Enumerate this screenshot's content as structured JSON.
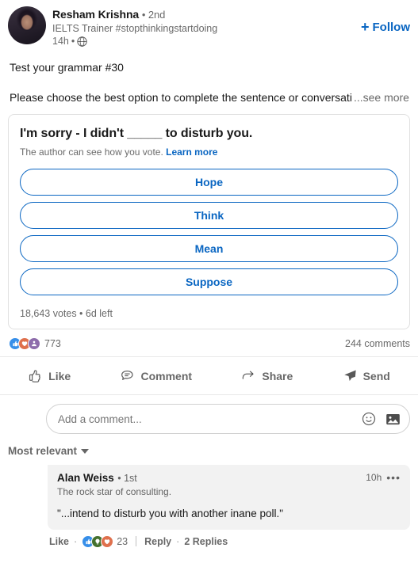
{
  "post": {
    "author": {
      "name": "Resham Krishna",
      "degree": "• 2nd",
      "headline": "IELTS Trainer #stopthinkingstartdoing",
      "time": "14h",
      "visibility_icon": "globe-icon",
      "avatar_alt": "author-avatar"
    },
    "follow_label": "Follow",
    "follow_plus": "+",
    "text_line1": "Test your grammar #30",
    "text_line2": "Please choose the best option to complete the sentence or conversati",
    "see_more": "...see more"
  },
  "poll": {
    "question": "I'm sorry - I didn't _____ to disturb you.",
    "subtext": "The author can see how you vote.",
    "learn_more": "Learn more",
    "options": [
      {
        "label": "Hope"
      },
      {
        "label": "Think"
      },
      {
        "label": "Mean"
      },
      {
        "label": "Suppose"
      }
    ],
    "footer": "18,643 votes • 6d left"
  },
  "social": {
    "reaction_icons": [
      "like-reaction-icon",
      "love-reaction-icon",
      "support-reaction-icon"
    ],
    "reaction_count": "773",
    "comments_count": "244 comments"
  },
  "actions": [
    {
      "label": "Like",
      "icon": "thumbs-up-icon"
    },
    {
      "label": "Comment",
      "icon": "comment-bubble-icon"
    },
    {
      "label": "Share",
      "icon": "share-arrow-icon"
    },
    {
      "label": "Send",
      "icon": "send-paperplane-icon"
    }
  ],
  "comment_input": {
    "placeholder": "Add a comment...",
    "emoji_icon": "emoji-smiley-icon",
    "image_icon": "image-photo-icon"
  },
  "sort": {
    "label": "Most relevant",
    "caret_icon": "chevron-down-icon"
  },
  "comments": [
    {
      "name": "Alan Weiss",
      "degree": "• 1st",
      "headline": "The rock star of consulting.",
      "time": "10h",
      "menu_icon": "more-options-icon",
      "text": "\"...intend to disturb you with another inane poll.\"",
      "like_label": "Like",
      "reaction_icons": [
        "like-reaction-icon",
        "insightful-reaction-icon",
        "love-reaction-icon"
      ],
      "reaction_count": "23",
      "reply_label": "Reply",
      "replies_label": "2 Replies",
      "separator": "·"
    }
  ],
  "colors": {
    "brand_blue": "#0a66c2",
    "reaction_like": "#378fe9",
    "reaction_love": "#df704d",
    "reaction_support": "#8d6cab",
    "reaction_insight": "#44712e",
    "bubble_grey": "#f2f2f2",
    "text_primary": "rgba(0,0,0,0.9)",
    "text_secondary": "rgba(0,0,0,0.6)"
  }
}
